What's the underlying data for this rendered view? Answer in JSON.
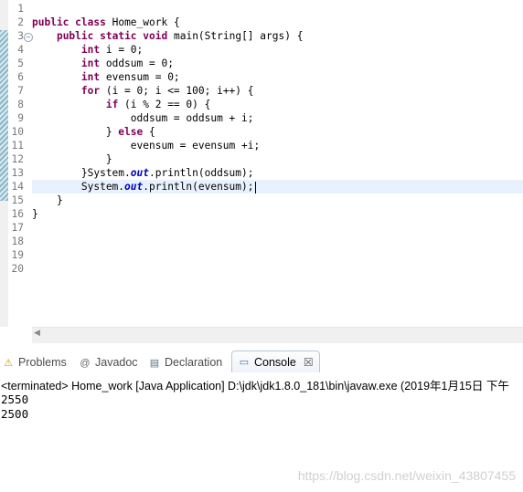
{
  "editor": {
    "line_numbers": [
      "1",
      "2",
      "3",
      "4",
      "5",
      "6",
      "7",
      "8",
      "9",
      "10",
      "11",
      "12",
      "13",
      "14",
      "15",
      "16",
      "17",
      "18",
      "19",
      "20"
    ],
    "lines": [
      [],
      [
        {
          "t": "public",
          "c": "kw"
        },
        {
          "t": " "
        },
        {
          "t": "class",
          "c": "kw"
        },
        {
          "t": " Home_work {"
        }
      ],
      [
        {
          "t": "    "
        },
        {
          "t": "public",
          "c": "kw"
        },
        {
          "t": " "
        },
        {
          "t": "static",
          "c": "kw"
        },
        {
          "t": " "
        },
        {
          "t": "void",
          "c": "kw"
        },
        {
          "t": " main(String[] args) {"
        }
      ],
      [
        {
          "t": "        "
        },
        {
          "t": "int",
          "c": "kw"
        },
        {
          "t": " i = 0;"
        }
      ],
      [
        {
          "t": "        "
        },
        {
          "t": "int",
          "c": "kw"
        },
        {
          "t": " oddsum = 0;"
        }
      ],
      [
        {
          "t": "        "
        },
        {
          "t": "int",
          "c": "kw"
        },
        {
          "t": " evensum = 0;"
        }
      ],
      [
        {
          "t": "        "
        },
        {
          "t": "for",
          "c": "kw"
        },
        {
          "t": " (i = 0; i <= 100; i++) {"
        }
      ],
      [
        {
          "t": "            "
        },
        {
          "t": "if",
          "c": "kw"
        },
        {
          "t": " (i % 2 == 0) {"
        }
      ],
      [
        {
          "t": "                oddsum = oddsum + i;"
        }
      ],
      [
        {
          "t": "            } "
        },
        {
          "t": "else",
          "c": "kw"
        },
        {
          "t": " {"
        }
      ],
      [
        {
          "t": "                evensum = evensum +i;"
        }
      ],
      [
        {
          "t": "            }"
        }
      ],
      [
        {
          "t": "        }System."
        },
        {
          "t": "out",
          "c": "st"
        },
        {
          "t": ".println(oddsum);"
        }
      ],
      [
        {
          "t": "        System."
        },
        {
          "t": "out",
          "c": "st"
        },
        {
          "t": ".println(evensum);"
        }
      ],
      [
        {
          "t": "    }"
        }
      ],
      [
        {
          "t": "}"
        }
      ],
      [],
      [],
      [],
      []
    ],
    "fold_marker": "−",
    "scroll_left_arrow": "◀"
  },
  "views": {
    "tabs": [
      {
        "label": "Problems",
        "icon": "problems-icon",
        "glyph": "⚠"
      },
      {
        "label": "Javadoc",
        "icon": "javadoc-icon",
        "glyph": "@"
      },
      {
        "label": "Declaration",
        "icon": "declaration-icon",
        "glyph": "▤"
      },
      {
        "label": "Console",
        "icon": "console-icon",
        "glyph": "▭"
      }
    ],
    "console_close": "☒"
  },
  "console": {
    "status": "<terminated> Home_work [Java Application] D:\\jdk\\jdk1.8.0_181\\bin\\javaw.exe (2019年1月15日 下午",
    "output": [
      "2550",
      "2500"
    ]
  },
  "watermark": "https://blog.csdn.net/weixin_43807455",
  "colors": {
    "keyword": "#7f0055",
    "static_field": "#0000c0",
    "current_line": "#e8f2fe",
    "change_bar": "#8cb7c8"
  }
}
